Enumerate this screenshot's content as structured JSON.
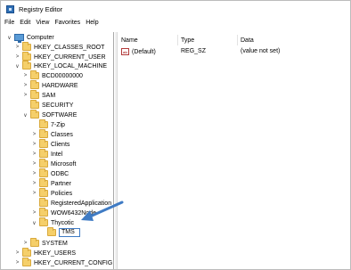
{
  "window": {
    "title": "Registry Editor"
  },
  "menu": [
    "File",
    "Edit",
    "View",
    "Favorites",
    "Help"
  ],
  "tree": {
    "computer": "Computer",
    "hkcr": "HKEY_CLASSES_ROOT",
    "hkcu": "HKEY_CURRENT_USER",
    "hklm": "HKEY_LOCAL_MACHINE",
    "bcd": "BCD00000000",
    "hardware": "HARDWARE",
    "sam": "SAM",
    "security": "SECURITY",
    "software": "SOFTWARE",
    "zip": "7-Zip",
    "classes": "Classes",
    "clients": "Clients",
    "intel": "Intel",
    "microsoft": "Microsoft",
    "odbc": "ODBC",
    "partner": "Partner",
    "policies": "Policies",
    "regapps": "RegisteredApplication",
    "wow": "WOW6432Node",
    "thycotic": "Thycotic",
    "tms_edit_value": "TMS",
    "system": "SYSTEM",
    "hku": "HKEY_USERS",
    "hkcc": "HKEY_CURRENT_CONFIG"
  },
  "list": {
    "headers": {
      "name": "Name",
      "type": "Type",
      "data": "Data"
    },
    "rows": [
      {
        "name": "(Default)",
        "type": "REG_SZ",
        "data": "(value not set)",
        "icon": "string-value-icon"
      }
    ]
  },
  "colors": {
    "folder": "#f5cf6a",
    "arrow": "#3f7bc4",
    "edit_border": "#3f7bc4"
  }
}
